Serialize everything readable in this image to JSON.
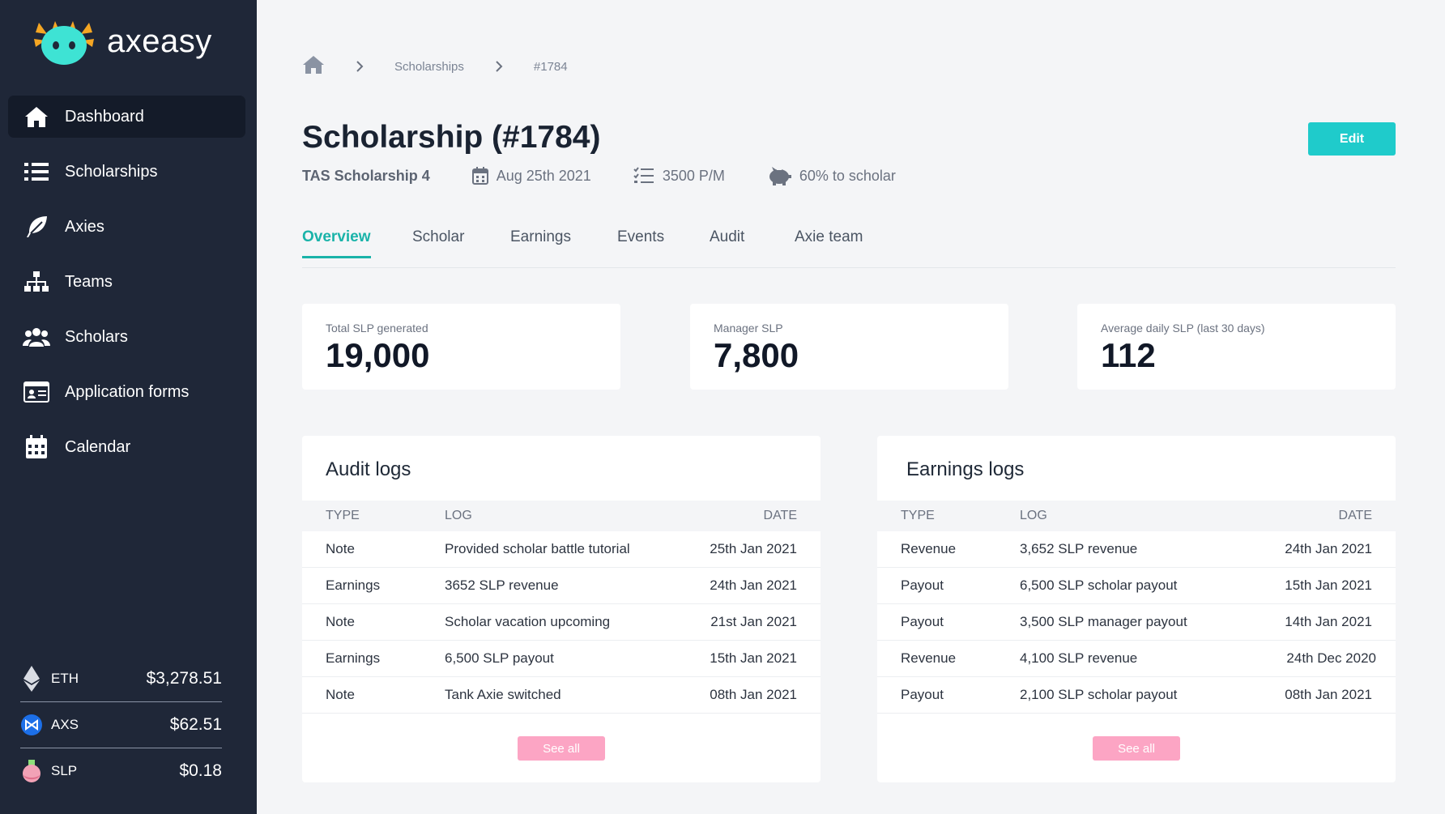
{
  "app": {
    "name": "axeasy"
  },
  "sidebar": {
    "items": [
      {
        "label": "Dashboard",
        "icon": "home-icon",
        "active": true
      },
      {
        "label": "Scholarships",
        "icon": "list-icon"
      },
      {
        "label": "Axies",
        "icon": "feather-icon"
      },
      {
        "label": "Teams",
        "icon": "sitemap-icon"
      },
      {
        "label": "Scholars",
        "icon": "users-icon"
      },
      {
        "label": "Application forms",
        "icon": "id-card-icon"
      },
      {
        "label": "Calendar",
        "icon": "calendar-icon"
      }
    ],
    "prices": [
      {
        "symbol": "ETH",
        "value": "$3,278.51",
        "icon": "ethereum-icon"
      },
      {
        "symbol": "AXS",
        "value": "$62.51",
        "icon": "axs-icon"
      },
      {
        "symbol": "SLP",
        "value": "$0.18",
        "icon": "slp-potion-icon"
      }
    ]
  },
  "breadcrumb": {
    "items": [
      "Scholarships",
      "#1784"
    ]
  },
  "page": {
    "title": "Scholarship (#1784)",
    "edit_label": "Edit",
    "meta": {
      "name": "TAS Scholarship 4",
      "date": "Aug 25th 2021",
      "rate": "3500 P/M",
      "split": "60% to scholar"
    }
  },
  "tabs": [
    "Overview",
    "Scholar",
    "Earnings",
    "Events",
    "Audit",
    "Axie team"
  ],
  "stats": [
    {
      "label": "Total SLP generated",
      "value": "19,000"
    },
    {
      "label": "Manager SLP",
      "value": "7,800"
    },
    {
      "label": "Average daily SLP (last 30 days)",
      "value": "112"
    }
  ],
  "audit_logs": {
    "title": "Audit logs",
    "columns": [
      "TYPE",
      "LOG",
      "DATE"
    ],
    "rows": [
      [
        "Note",
        "Provided scholar battle tutorial",
        "25th Jan 2021"
      ],
      [
        "Earnings",
        "3652 SLP revenue",
        "24th Jan 2021"
      ],
      [
        "Note",
        "Scholar vacation upcoming",
        "21st Jan 2021"
      ],
      [
        "Earnings",
        "6,500 SLP payout",
        "15th Jan 2021"
      ],
      [
        "Note",
        "Tank Axie switched",
        "08th Jan 2021"
      ]
    ],
    "see_all": "See all"
  },
  "earnings_logs": {
    "title": "Earnings logs",
    "columns": [
      "TYPE",
      "LOG",
      "DATE"
    ],
    "rows": [
      [
        "Revenue",
        "3,652 SLP revenue",
        "24th Jan 2021"
      ],
      [
        "Payout",
        "6,500 SLP scholar payout",
        "15th Jan 2021"
      ],
      [
        "Payout",
        "3,500 SLP manager payout",
        "14th Jan 2021"
      ],
      [
        "Revenue",
        "4,100 SLP revenue",
        "24th Dec 2020"
      ],
      [
        "Payout",
        "2,100 SLP scholar payout",
        "08th Jan 2021"
      ]
    ],
    "see_all": "See all"
  },
  "colors": {
    "sidebar": "#1f2738",
    "accent": "#1fcbcb",
    "tab_active": "#1ab3a9",
    "see_all": "#fca5c4"
  }
}
